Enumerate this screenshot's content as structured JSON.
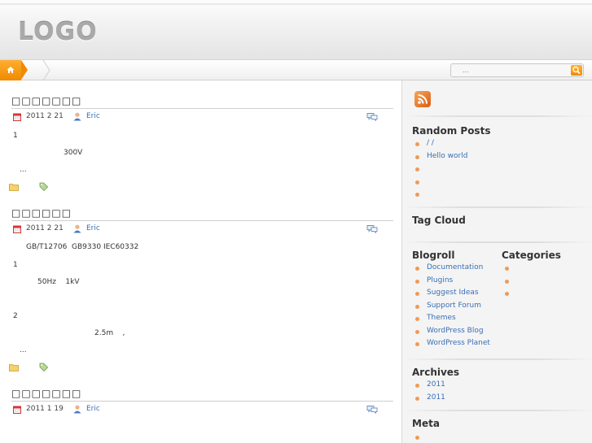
{
  "header": {
    "logo": "LOGO"
  },
  "nav": {
    "search_placeholder": "..."
  },
  "posts": [
    {
      "title": "□□□□□□□",
      "date": "2011 2 21",
      "author": "Eric",
      "lines": [
        "1",
        "300V",
        "..."
      ]
    },
    {
      "title": "□□□□□□",
      "date": "2011 2 21",
      "author": "Eric",
      "lines": [
        "GB/T12706  GB9330 IEC60332",
        "1",
        "50Hz    1kV",
        "2",
        "2.5m    ,",
        "..."
      ]
    },
    {
      "title": "□□□□□□□",
      "date": "2011 1 19",
      "author": "Eric",
      "lines": []
    }
  ],
  "sidebar": {
    "random_posts": {
      "title": "Random Posts",
      "items": [
        "/  /",
        "Hello world",
        "",
        "",
        ""
      ]
    },
    "tag_cloud": {
      "title": "Tag Cloud"
    },
    "blogroll": {
      "title": "Blogroll",
      "items": [
        "Documentation",
        "Plugins",
        "Suggest Ideas",
        "Support Forum",
        "Themes",
        "WordPress Blog",
        "WordPress Planet"
      ]
    },
    "categories": {
      "title": "Categories",
      "items": [
        "",
        "",
        ""
      ]
    },
    "archives": {
      "title": "Archives",
      "items": [
        "2011",
        "2011"
      ]
    },
    "meta": {
      "title": "Meta",
      "items": [
        ""
      ]
    }
  },
  "colors": {
    "accent": "#f08a00",
    "link": "#3a6fb5",
    "bullet": "#f09a55"
  }
}
